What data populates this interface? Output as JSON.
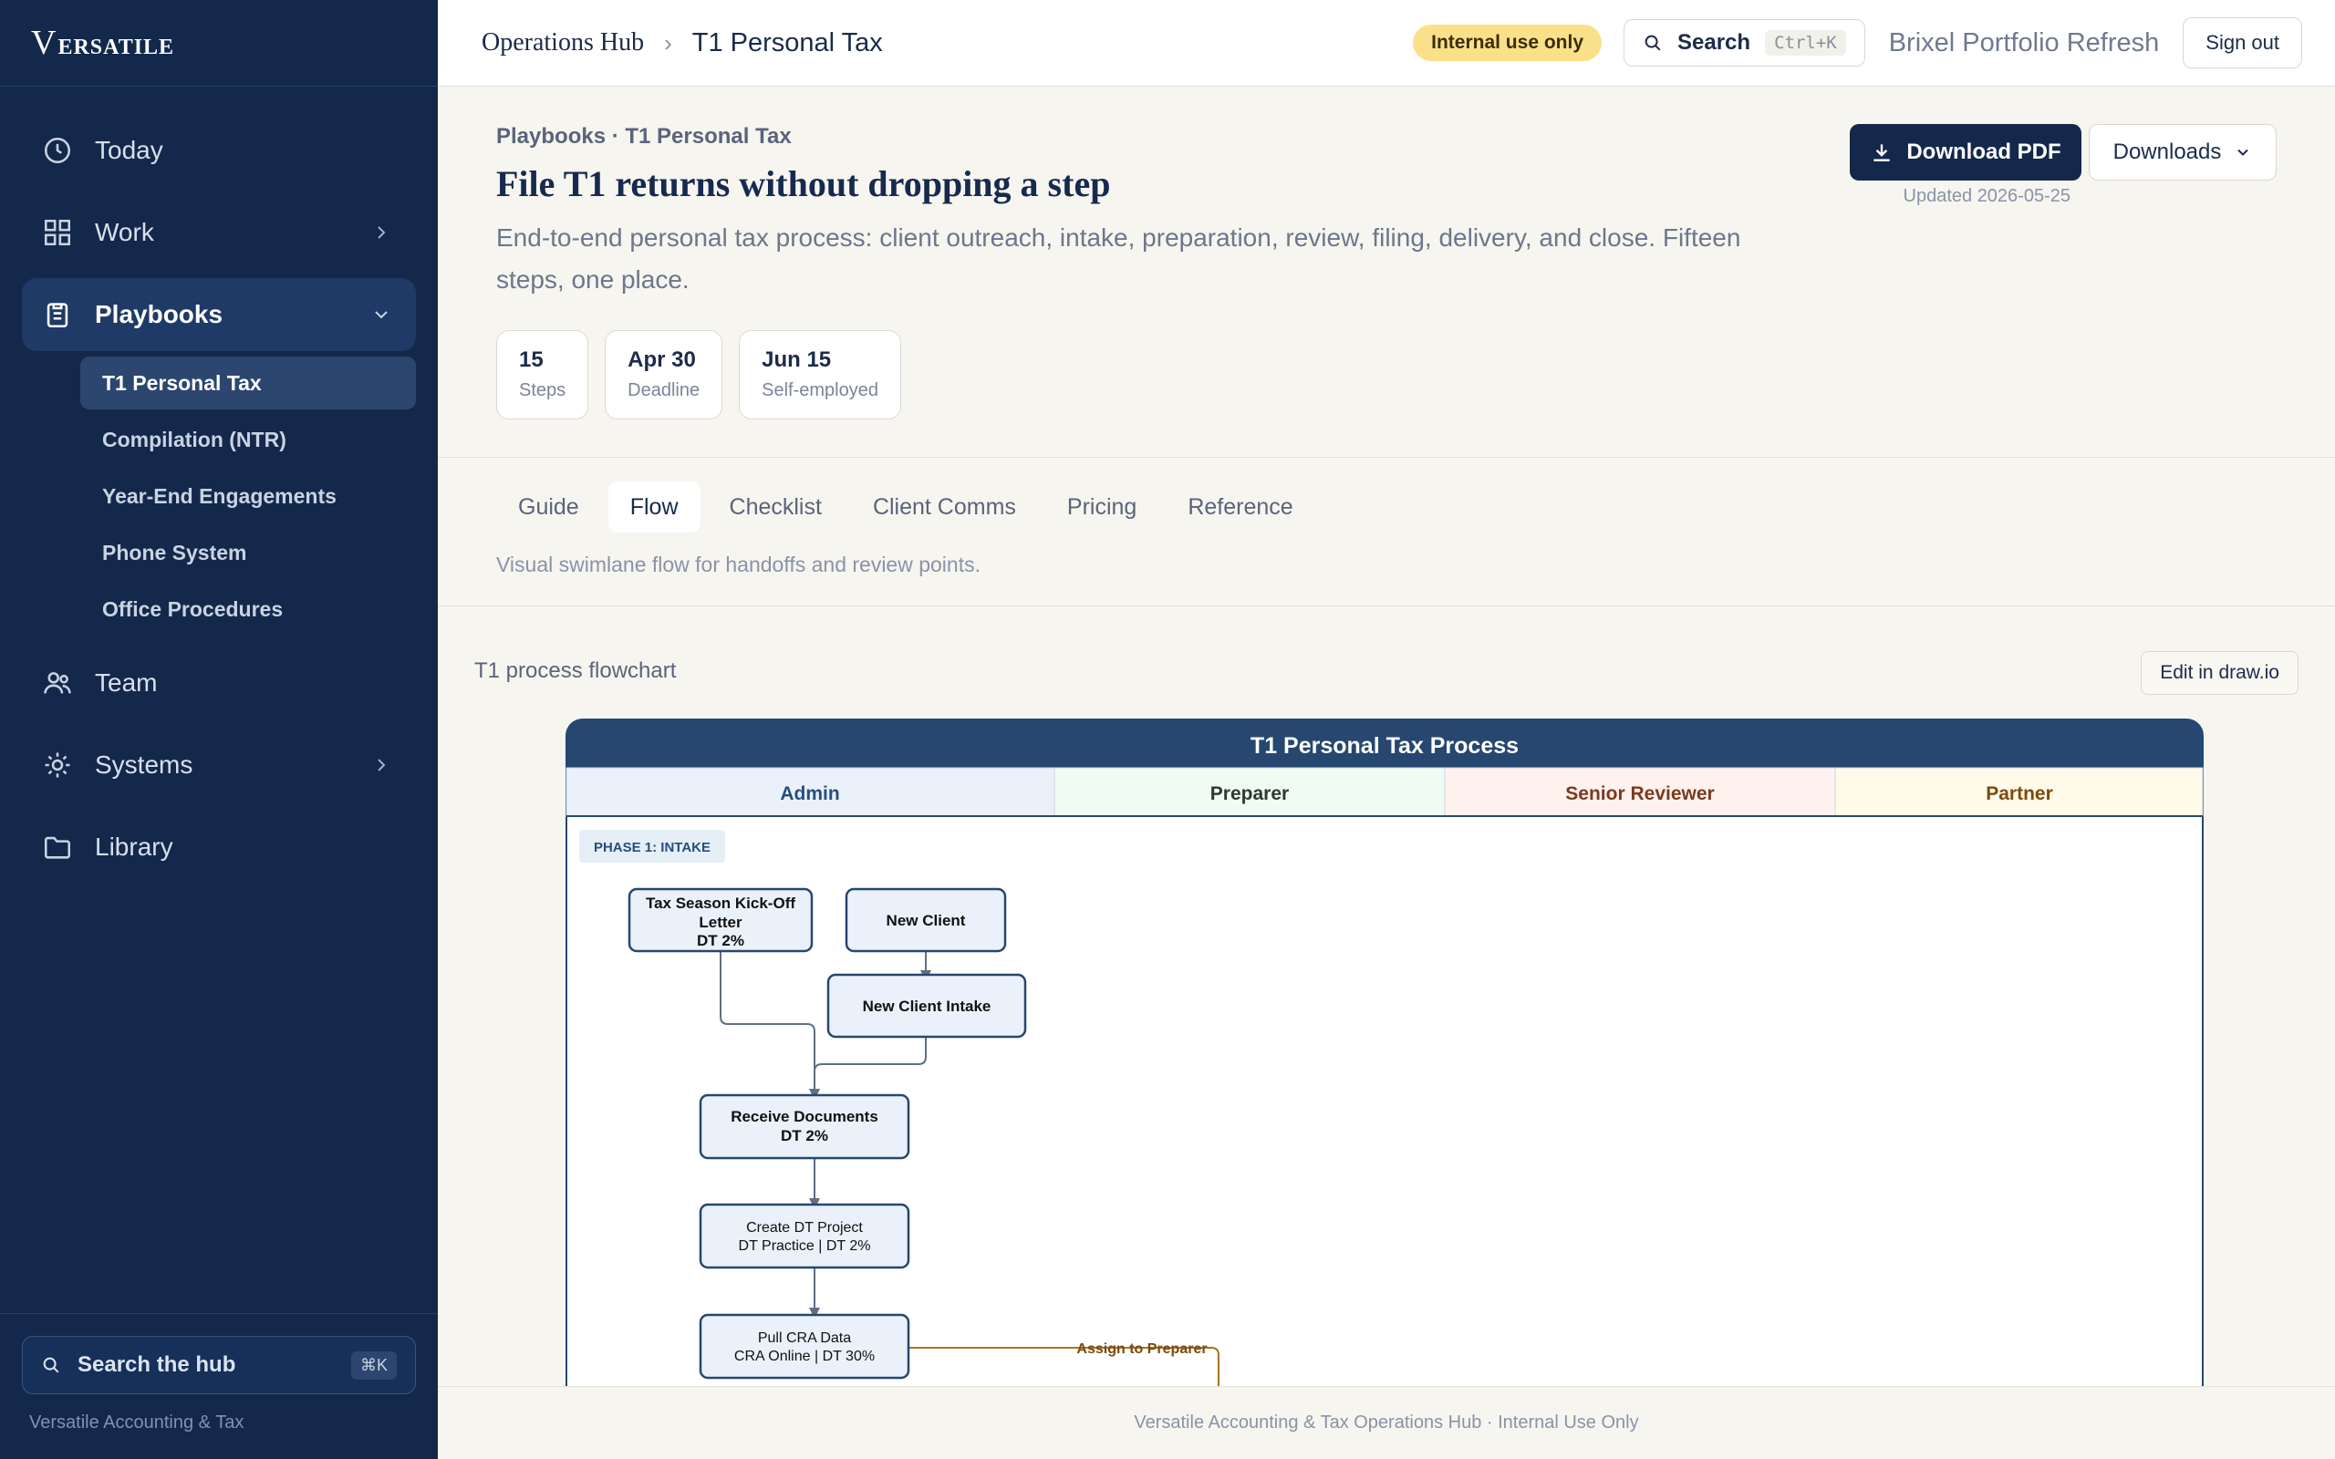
{
  "sidebar": {
    "brand": "VERSATILE",
    "nav": [
      {
        "label": "Today",
        "icon": "clock-icon"
      },
      {
        "label": "Work",
        "icon": "grid-icon"
      },
      {
        "label": "Playbooks",
        "icon": "clipboard-icon"
      },
      {
        "label": "Team",
        "icon": "users-icon"
      },
      {
        "label": "Systems",
        "icon": "gear-icon"
      },
      {
        "label": "Library",
        "icon": "folder-icon"
      }
    ],
    "playbooks": [
      "T1 Personal Tax",
      "Compilation (NTR)",
      "Year-End Engagements",
      "Phone System",
      "Office Procedures"
    ],
    "search_label": "Search the hub",
    "search_shortcut": "⌘K",
    "org": "Versatile Accounting & Tax"
  },
  "topbar": {
    "hub": "Operations Hub",
    "separator": "›",
    "page": "T1 Personal Tax",
    "badge": "Internal use only",
    "search_label": "Search",
    "search_shortcut": "Ctrl+K",
    "project": "Brixel Portfolio Refresh",
    "signout": "Sign out"
  },
  "hero": {
    "crumb": "Playbooks · T1 Personal Tax",
    "title": "File T1 returns without dropping a step",
    "description": "End-to-end personal tax process: client outreach, intake, preparation, review, filing, delivery, and close. Fifteen steps, one place.",
    "stats": [
      {
        "value": "15",
        "label": "Steps"
      },
      {
        "value": "Apr 30",
        "label": "Deadline"
      },
      {
        "value": "Jun 15",
        "label": "Self-employed"
      }
    ],
    "download_pdf": "Download PDF",
    "downloads": "Downloads",
    "updated": "Updated 2026-05-25"
  },
  "tabs": {
    "items": [
      "Guide",
      "Flow",
      "Checklist",
      "Client Comms",
      "Pricing",
      "Reference"
    ],
    "active": "Flow",
    "caption": "Visual swimlane flow for handoffs and review points."
  },
  "flow": {
    "heading": "T1 process flowchart",
    "edit_button": "Edit in draw.io",
    "diagram_title": "T1 Personal Tax Process",
    "lanes": [
      "Admin",
      "Preparer",
      "Senior Reviewer",
      "Partner"
    ],
    "lane_colors": [
      "#eaf1fb",
      "#effbf3",
      "#fff2ee",
      "#fffbe8"
    ],
    "lane_text_colors": [
      "#274e7c",
      "#2c3a2f",
      "#7a3b1e",
      "#7a4a12"
    ],
    "phase_label": "PHASE 1: INTAKE",
    "nodes": {
      "kickoff": [
        "Tax Season Kick-Off",
        "Letter",
        "DT 2%"
      ],
      "new_client": [
        "New Client"
      ],
      "intake": [
        "New Client Intake"
      ],
      "receive": [
        "Receive Documents",
        "DT 2%"
      ],
      "create_project": [
        "Create DT Project",
        "DT Practice | DT 2%"
      ],
      "pull_cra": [
        "Pull CRA Data",
        "CRA Online | DT 30%"
      ]
    },
    "edge_label": "Assign to Preparer"
  },
  "footer": "Versatile Accounting & Tax Operations Hub · Internal Use Only"
}
